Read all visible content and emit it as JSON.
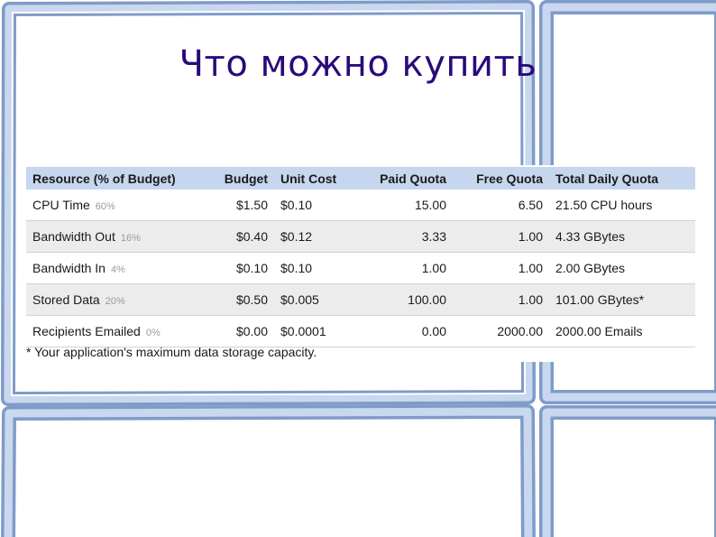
{
  "slide": {
    "title": "Что можно купить",
    "footnote": "* Your application's maximum data storage capacity."
  },
  "table": {
    "headers": [
      "Resource (% of Budget)",
      "Budget",
      "Unit Cost",
      "Paid Quota",
      "Free Quota",
      "Total Daily Quota"
    ],
    "rows": [
      {
        "resource": "CPU Time",
        "pct": "60%",
        "budget": "$1.50",
        "unit_cost": "$0.10",
        "paid": "15.00",
        "free": "6.50",
        "total": "21.50 CPU hours"
      },
      {
        "resource": "Bandwidth Out",
        "pct": "16%",
        "budget": "$0.40",
        "unit_cost": "$0.12",
        "paid": "3.33",
        "free": "1.00",
        "total": "4.33 GBytes"
      },
      {
        "resource": "Bandwidth In",
        "pct": "4%",
        "budget": "$0.10",
        "unit_cost": "$0.10",
        "paid": "1.00",
        "free": "1.00",
        "total": "2.00 GBytes"
      },
      {
        "resource": "Stored Data",
        "pct": "20%",
        "budget": "$0.50",
        "unit_cost": "$0.005",
        "paid": "100.00",
        "free": "1.00",
        "total": "101.00 GBytes*"
      },
      {
        "resource": "Recipients Emailed",
        "pct": "0%",
        "budget": "$0.00",
        "unit_cost": "$0.0001",
        "paid": "0.00",
        "free": "2000.00",
        "total": "2000.00 Emails"
      }
    ]
  },
  "colors": {
    "title": "#2a0a7a",
    "frame": "#a9bfe0",
    "frame_edge": "#7f9bc8",
    "header_bg": "#c6d6ee",
    "stripe": "#ececec"
  }
}
